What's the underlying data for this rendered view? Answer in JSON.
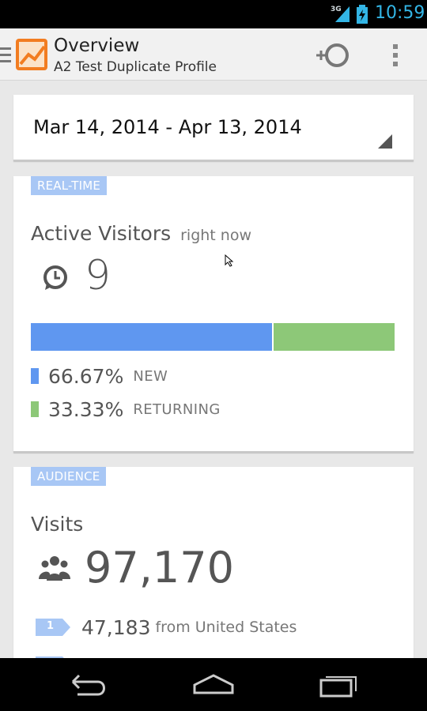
{
  "status_bar": {
    "network": "3G",
    "time": "10:59"
  },
  "action_bar": {
    "title": "Overview",
    "subtitle": "A2 Test Duplicate Profile",
    "icons": [
      "drawer-icon",
      "analytics-logo",
      "add-segment-icon",
      "overflow-menu-icon"
    ]
  },
  "date_range": {
    "label": "Mar 14, 2014 - Apr 13, 2014"
  },
  "realtime": {
    "tag": "REAL-TIME",
    "heading": "Active Visitors",
    "heading_sub": "right now",
    "count": "9",
    "new_fraction": 0.6667,
    "new_pct": "66.67%",
    "new_label": "NEW",
    "returning_pct": "33.33%",
    "returning_label": "RETURNING",
    "colors": {
      "new": "#5f97f0",
      "returning": "#8dc878"
    }
  },
  "audience": {
    "tag": "AUDIENCE",
    "heading": "Visits",
    "visits": "97,170",
    "rows": [
      {
        "rank": "1",
        "value": "47,183",
        "label": "from United States"
      }
    ]
  },
  "colors": {
    "accent": "#33b5e5",
    "tag_bg": "#a8c7f5"
  }
}
